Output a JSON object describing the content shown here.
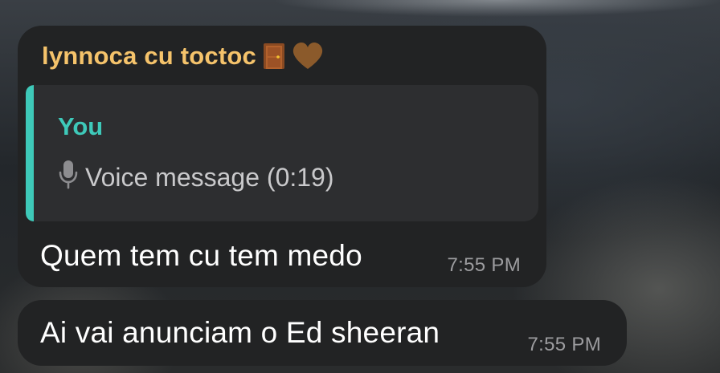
{
  "messages": [
    {
      "sender": "lynnoca cu toctoc",
      "sender_emoji": [
        "door-icon",
        "brown-heart-icon"
      ],
      "reply": {
        "author": "You",
        "icon": "microphone-icon",
        "text": "Voice message (0:19)"
      },
      "text": "Quem tem cu tem medo",
      "time": "7:55 PM"
    },
    {
      "text": "Ai vai anunciam o Ed sheeran",
      "time": "7:55 PM"
    }
  ],
  "colors": {
    "bubble": "#222324",
    "sender_name": "#f5c36b",
    "reply_accent": "#3ec9b9",
    "timestamp": "#9c9c9f"
  }
}
